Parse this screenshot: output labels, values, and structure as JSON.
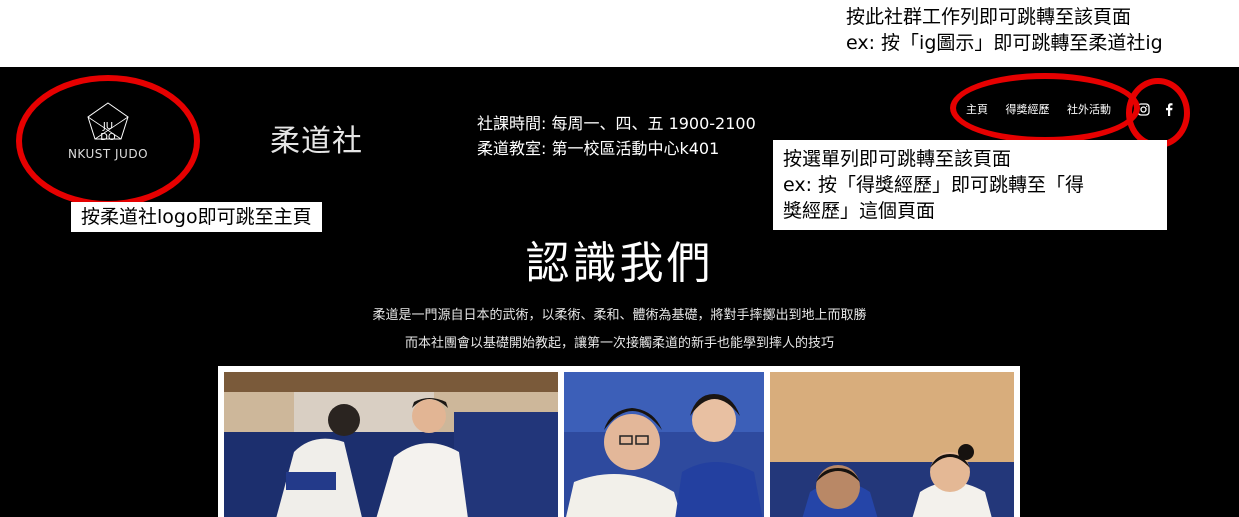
{
  "annotation_top": {
    "line1": "按此社群工作列即可跳轉至該頁面",
    "line2": "ex: 按「ig圖示」即可跳轉至柔道社ig"
  },
  "logo": {
    "top": "JU",
    "bottom": "DO",
    "text": "NKUST JUDO"
  },
  "site_title": "柔道社",
  "info": {
    "line1": "社課時間: 每周一、四、五 1900-2100",
    "line2": "柔道教室: 第一校區活動中心k401"
  },
  "nav": {
    "items": [
      {
        "label": "主頁"
      },
      {
        "label": "得獎經歷"
      },
      {
        "label": "社外活動"
      }
    ]
  },
  "social": {
    "icons": [
      "instagram-icon",
      "facebook-icon"
    ]
  },
  "callouts": {
    "logo": "按柔道社logo即可跳至主頁",
    "menu_line1": "按選單列即可跳轉至該頁面",
    "menu_line2": "ex: 按「得獎經歷」即可跳轉至「得",
    "menu_line3": "獎經歷」這個頁面"
  },
  "section": {
    "heading": "認識我們",
    "desc1": "柔道是一門源自日本的武術，以柔術、柔和、體術為基礎，將對手摔擲出到地上而取勝",
    "desc2": "而本社團會以基礎開始教起，讓第一次接觸柔道的新手也能學到摔人的技巧"
  },
  "colors": {
    "annotation_red": "#e60000",
    "background": "#000000",
    "text": "#ffffff"
  }
}
